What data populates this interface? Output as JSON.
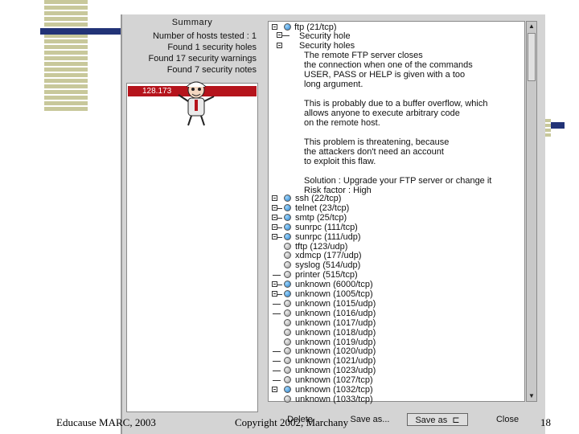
{
  "slide": {
    "footer_left": "Educause MARC, 2003",
    "footer_center": "Copyright 2002, Marchany",
    "page_number": "18",
    "colors": {
      "accent_dark": "#223377",
      "stripe": "#c8c89b"
    }
  },
  "summary": {
    "title": "Summary",
    "lines": [
      "Number of hosts tested : 1",
      "Found 1 security holes",
      "Found 17 security warnings",
      "Found 7 security notes"
    ]
  },
  "hosts": [
    {
      "label": "128.173",
      "selected": true,
      "color": "#b5141c"
    }
  ],
  "tree": {
    "ftp": {
      "label": "ftp (21/tcp)",
      "children": [
        "Security hole",
        "Security holes"
      ],
      "report": [
        "The remote FTP server closes",
        "the connection when one of the commands",
        "USER, PASS or HELP is given with a too",
        "long argument.",
        "",
        "This is probably due to a buffer overflow, which",
        "allows anyone to execute arbitrary code",
        "on the remote host.",
        "",
        "This problem is threatening, because",
        "the attackers don't need an account",
        "to exploit this flaw.",
        "",
        "Solution : Upgrade your FTP server or change it",
        "Risk factor : High"
      ]
    },
    "services": [
      {
        "label": "ssh (22/tcp)",
        "expander": "box",
        "dot": "blue"
      },
      {
        "label": "telnet (23/tcp)",
        "expander": "box-line",
        "dot": "blue"
      },
      {
        "label": "smtp (25/tcp)",
        "expander": "box-line",
        "dot": "blue"
      },
      {
        "label": "sunrpc (111/tcp)",
        "expander": "box-line",
        "dot": "blue"
      },
      {
        "label": "sunrpc (111/udp)",
        "expander": "box-line",
        "dot": "blue"
      },
      {
        "label": "tftp (123/udp)",
        "expander": "none",
        "dot": "grey"
      },
      {
        "label": "xdmcp (177/udp)",
        "expander": "none",
        "dot": "grey"
      },
      {
        "label": "syslog (514/udp)",
        "expander": "none",
        "dot": "grey"
      },
      {
        "label": "printer (515/tcp)",
        "expander": "dash",
        "dot": "grey"
      },
      {
        "label": "unknown (6000/tcp)",
        "expander": "box-line",
        "dot": "blue"
      },
      {
        "label": "unknown (1005/tcp)",
        "expander": "box-line",
        "dot": "blue"
      },
      {
        "label": "unknown (1015/udp)",
        "expander": "dash",
        "dot": "grey"
      },
      {
        "label": "unknown (1016/udp)",
        "expander": "dash",
        "dot": "grey"
      },
      {
        "label": "unknown (1017/udp)",
        "expander": "none",
        "dot": "grey"
      },
      {
        "label": "unknown (1018/udp)",
        "expander": "none",
        "dot": "grey"
      },
      {
        "label": "unknown (1019/udp)",
        "expander": "none",
        "dot": "grey"
      },
      {
        "label": "unknown (1020/udp)",
        "expander": "dash",
        "dot": "grey"
      },
      {
        "label": "unknown (1021/udp)",
        "expander": "dash",
        "dot": "grey"
      },
      {
        "label": "unknown (1023/udp)",
        "expander": "dash",
        "dot": "grey"
      },
      {
        "label": "unknown (1027/tcp)",
        "expander": "dash",
        "dot": "grey"
      },
      {
        "label": "unknown (1032/tcp)",
        "expander": "box",
        "dot": "blue"
      },
      {
        "label": "unknown (1033/tcp)",
        "expander": "none",
        "dot": "grey"
      }
    ]
  },
  "buttons": {
    "delete": "Delete",
    "save_as": "Save as...",
    "save_as_nsr": "Save as",
    "close": "Close"
  }
}
